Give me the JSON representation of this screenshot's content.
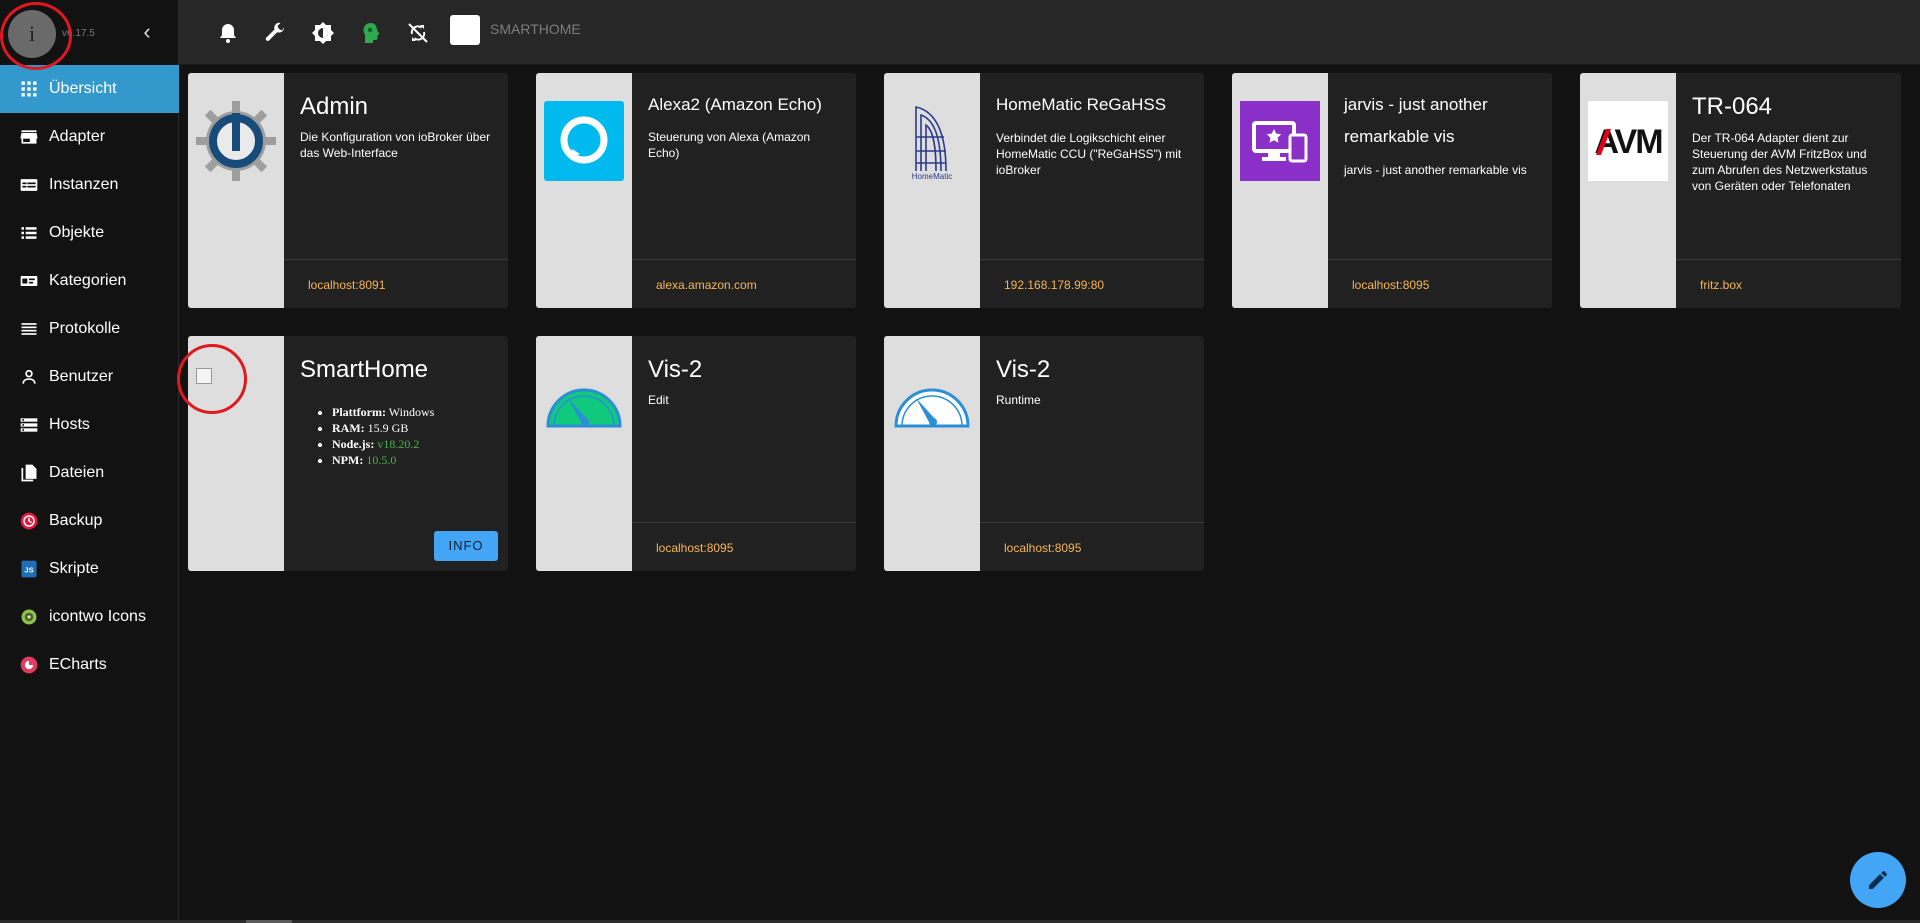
{
  "app": {
    "logo_letter": "i",
    "version": "v6.17.5",
    "collapse_glyph": "‹",
    "host_name": "SMARTHOME",
    "accent_color": "#3399cc",
    "fab_color": "#42a5f5"
  },
  "sidebar": {
    "items": [
      {
        "label": "Übersicht",
        "icon": "apps-grid-icon",
        "active": true
      },
      {
        "label": "Adapter",
        "icon": "store-icon",
        "active": false
      },
      {
        "label": "Instanzen",
        "icon": "instances-icon",
        "active": false
      },
      {
        "label": "Objekte",
        "icon": "list-icon",
        "active": false
      },
      {
        "label": "Kategorien",
        "icon": "category-card-icon",
        "active": false
      },
      {
        "label": "Protokolle",
        "icon": "lines-icon",
        "active": false
      },
      {
        "label": "Benutzer",
        "icon": "person-icon",
        "active": false
      },
      {
        "label": "Hosts",
        "icon": "storage-icon",
        "active": false
      },
      {
        "label": "Dateien",
        "icon": "file-copy-icon",
        "active": false
      },
      {
        "label": "Backup",
        "icon": "backup-history-icon",
        "active": false
      },
      {
        "label": "Skripte",
        "icon": "javascript-icon",
        "active": false
      },
      {
        "label": "icontwo Icons",
        "icon": "icontwo-icon",
        "active": false
      },
      {
        "label": "ECharts",
        "icon": "echarts-icon",
        "active": false
      }
    ]
  },
  "toolbar": {
    "icons": [
      "bell-icon",
      "wrench-icon",
      "brightness-icon",
      "expert-mode-head-icon",
      "sync-disabled-icon"
    ]
  },
  "cards": [
    {
      "title": "Admin",
      "description": "Die Konfiguration von ioBroker über das Web-Interface",
      "link": "localhost:8091",
      "image": "iobroker-admin-logo-icon"
    },
    {
      "title": "Alexa2 (Amazon Echo)",
      "description": "Steuerung von Alexa (Amazon Echo)",
      "link": "alexa.amazon.com",
      "image": "alexa-logo-icon"
    },
    {
      "title": "HomeMatic ReGaHSS",
      "description": "Verbindet die Logikschicht einer HomeMatic CCU (\"ReGaHSS\") mit ioBroker",
      "link": "192.168.178.99:80",
      "image": "homematic-logo-icon",
      "image_text": "HomeMatic"
    },
    {
      "title": "jarvis - just another remarkable vis",
      "description": "jarvis - just another remarkable vis",
      "link": "localhost:8095",
      "image": "jarvis-logo-icon"
    },
    {
      "title": "TR-064",
      "description": "Der TR-064 Adapter dient zur Steuerung der AVM FritzBox und zum Abrufen des Netzwerkstatus von Geräten oder Telefonaten",
      "link": "fritz.box",
      "image": "avm-logo-icon",
      "image_text": "AVM"
    },
    {
      "title": "SmartHome",
      "image": "broken-image-icon",
      "info": [
        {
          "label": "Plattform:",
          "value": "Windows",
          "highlight": false
        },
        {
          "label": "RAM:",
          "value": "15.9 GB",
          "highlight": false
        },
        {
          "label": "Node.js:",
          "value": "v18.20.2",
          "highlight": true
        },
        {
          "label": "NPM:",
          "value": "10.5.0",
          "highlight": true
        }
      ],
      "button": "INFO"
    },
    {
      "title": "Vis-2",
      "description": "Edit",
      "link": "localhost:8095",
      "image": "vis2-gauge-green-icon"
    },
    {
      "title": "Vis-2",
      "description": "Runtime",
      "link": "localhost:8095",
      "image": "vis2-gauge-outline-icon"
    }
  ]
}
